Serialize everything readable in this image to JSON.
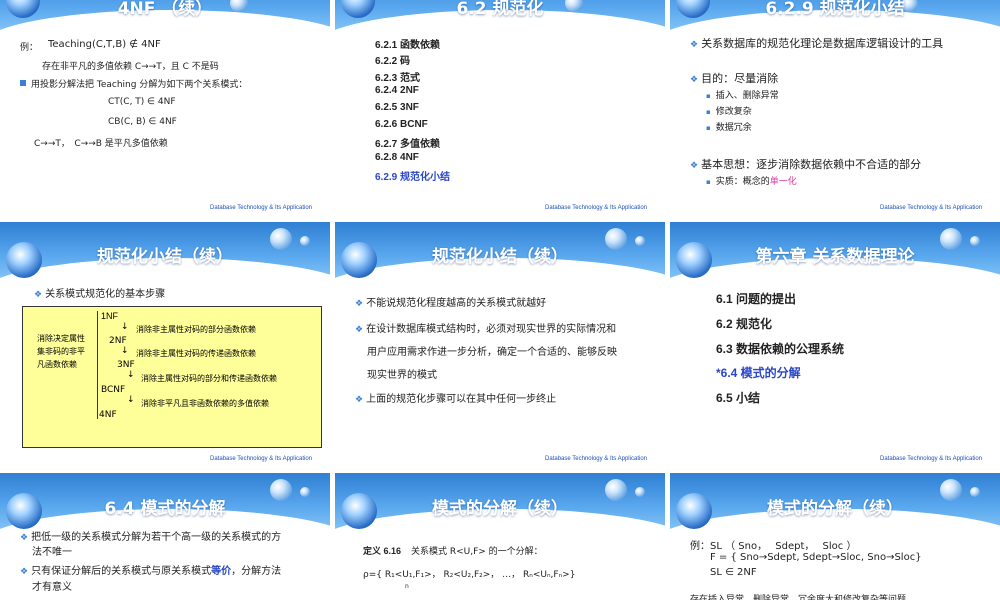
{
  "footer": "Database Technology & Its Application",
  "slides": {
    "s1": {
      "title": "4NF （续）",
      "example_label": "例：",
      "example_rel": "Teaching(C,T,B) ∉ 4NF",
      "line2": "存在非平凡的多值依赖 C→→T，且 C 不是码",
      "bullet": "用投影分解法把 Teaching 分解为如下两个关系模式：",
      "ct": "CT(C, T) ∈ 4NF",
      "cb": "CB(C, B) ∈ 4NF",
      "last": "C→→T，　C→→B 是平凡多值依赖"
    },
    "s2": {
      "title": "6.2  规范化",
      "items": [
        "6.2.1  函数依赖",
        "6.2.2  码",
        "6.2.3  范式",
        "6.2.4  2NF",
        "6.2.5  3NF",
        "6.2.6  BCNF",
        "6.2.7  多值依赖",
        "6.2.8  4NF",
        "6.2.9  规范化小结"
      ]
    },
    "s3": {
      "title": "6.2.9  规范化小结",
      "p1": "关系数据库的规范化理论是数据库逻辑设计的工具",
      "p2": "目的：尽量消除",
      "sub": [
        "插入、删除异常",
        "修改复杂",
        "数据冗余"
      ],
      "p3": "基本思想：逐步消除数据依赖中不合适的部分",
      "p4_pre": "实质：概念的",
      "p4_hl": "单一化"
    },
    "s4": {
      "title": "规范化小结（续）",
      "bullet": "关系模式规范化的基本步骤",
      "side": [
        "消除决定属性",
        "集非码的非平",
        "凡函数依赖"
      ],
      "nf": [
        "1NF",
        "2NF",
        "3NF",
        "BCNF",
        "4NF"
      ],
      "arrow": "↓",
      "steps": [
        "消除非主属性对码的部分函数依赖",
        "消除非主属性对码的传递函数依赖",
        "消除主属性对码的部分和传递函数依赖",
        "消除非平凡且非函数依赖的多值依赖"
      ]
    },
    "s5": {
      "title": "规范化小结（续）",
      "p1": "不能说规范化程度越高的关系模式就越好",
      "p2": [
        "在设计数据库模式结构时，必须对现实世界的实际情况和",
        "用户应用需求作进一步分析，确定一个合适的、能够反映",
        "现实世界的模式"
      ],
      "p3": "上面的规范化步骤可以在其中任何一步终止"
    },
    "s6": {
      "title": "第六章  关系数据理论",
      "items": [
        "6.1  问题的提出",
        "6.2  规范化",
        "6.3  数据依赖的公理系统",
        "*6.4  模式的分解",
        "6.5  小结"
      ]
    },
    "s7": {
      "title": "6.4  模式的分解",
      "p1": [
        "把低一级的关系模式分解为若干个高一级的关系模式的方",
        "法不唯一"
      ],
      "p2_pre": "只有保证分解后的关系模式与原关系模式",
      "p2_hl": "等价",
      "p2_post": "，分解方法",
      "p2_l2": "才有意义"
    },
    "s8": {
      "title": "模式的分解（续）",
      "def_label": "定义 6.16",
      "def_text": "关系模式 R<U,F> 的一个分解：",
      "formula": "ρ={ R₁<U₁,F₁>， R₂<U₂,F₂>， …， Rₙ<Uₙ,Fₙ>}",
      "small_n": "n"
    },
    "s9": {
      "title": "模式的分解（续）",
      "ex": "例：SL （ Sno，　 Sdept，　 Sloc ）",
      "f": "F = { Sno→Sdept, Sdept→Sloc, Sno→Sloc}",
      "sl": "SL ∈ 2NF",
      "last": "存在插入异常、删除异常、冗余度大和修改复杂等问题"
    }
  }
}
